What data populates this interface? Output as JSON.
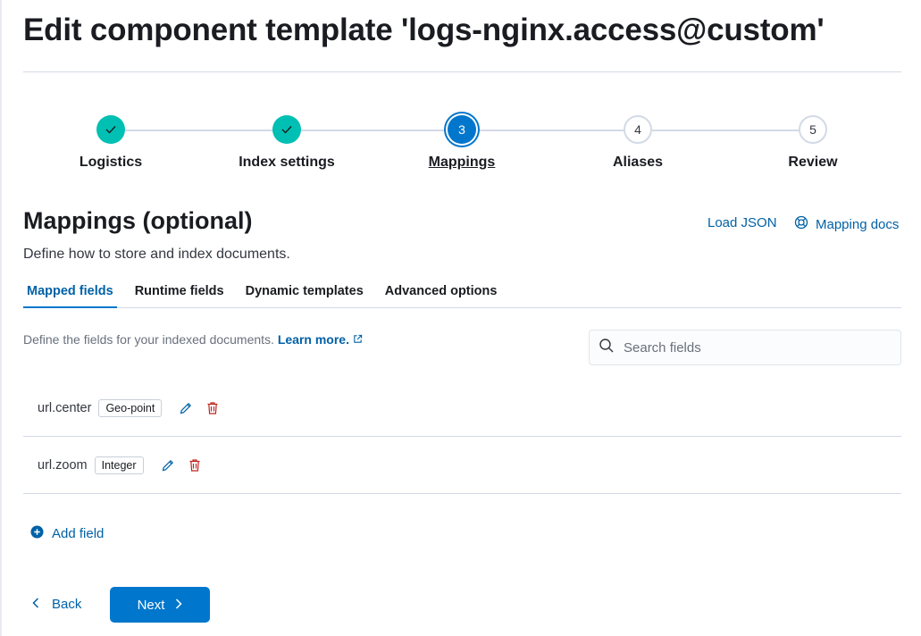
{
  "page": {
    "title": "Edit component template 'logs-nginx.access@custom'"
  },
  "stepper": {
    "steps": [
      {
        "label": "Logistics",
        "status": "complete",
        "number": "1"
      },
      {
        "label": "Index settings",
        "status": "complete",
        "number": "2"
      },
      {
        "label": "Mappings",
        "status": "current",
        "number": "3"
      },
      {
        "label": "Aliases",
        "status": "incomplete",
        "number": "4"
      },
      {
        "label": "Review",
        "status": "incomplete",
        "number": "5"
      }
    ]
  },
  "section": {
    "title": "Mappings (optional)",
    "description": "Define how to store and index documents.",
    "load_json": "Load JSON",
    "mapping_docs": "Mapping docs"
  },
  "tabs": [
    "Mapped fields",
    "Runtime fields",
    "Dynamic templates",
    "Advanced options"
  ],
  "fields_panel": {
    "description": "Define the fields for your indexed documents.",
    "learn_more": "Learn more.",
    "search_placeholder": "Search fields"
  },
  "fields": [
    {
      "name": "url.center",
      "type": "Geo-point"
    },
    {
      "name": "url.zoom",
      "type": "Integer"
    }
  ],
  "actions": {
    "add_field": "Add field",
    "back": "Back",
    "next": "Next"
  },
  "colors": {
    "accent": "#0077cc",
    "link": "#0061a6",
    "complete": "#00bfb3",
    "danger": "#bd271e"
  }
}
